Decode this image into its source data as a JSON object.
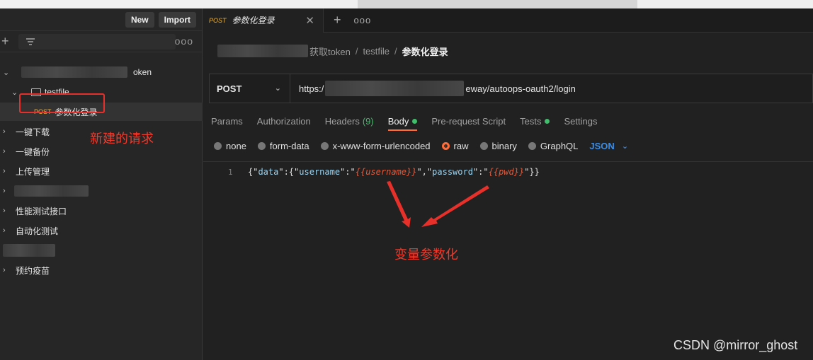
{
  "sidebar": {
    "new_label": "New",
    "import_label": "Import",
    "items": [
      {
        "label": "oken"
      },
      {
        "label": "testfile"
      },
      {
        "method": "POST",
        "label": "参数化登录"
      },
      {
        "label": "一键下载"
      },
      {
        "label": "一键备份"
      },
      {
        "label": "上传管理"
      },
      {
        "label": "性能测试接口"
      },
      {
        "label": "自动化测试"
      },
      {
        "label": "预约疫苗"
      }
    ]
  },
  "annotations": {
    "new_request": "新建的请求",
    "param_vars": "变量参数化"
  },
  "tab": {
    "method": "POST",
    "title": "参数化登录"
  },
  "breadcrumb": {
    "part1": "获取token",
    "part2": "testfile",
    "current": "参数化登录"
  },
  "request": {
    "method": "POST",
    "url_start": "https:/",
    "url_end": "eway/autoops-oauth2/login"
  },
  "req_tabs": {
    "params": "Params",
    "authorization": "Authorization",
    "headers": "Headers",
    "headers_count": "(9)",
    "body": "Body",
    "prerequest": "Pre-request Script",
    "tests": "Tests",
    "settings": "Settings"
  },
  "body_options": {
    "none": "none",
    "form_data": "form-data",
    "urlencoded": "x-www-form-urlencoded",
    "raw": "raw",
    "binary": "binary",
    "graphql": "GraphQL",
    "format": "JSON"
  },
  "editor": {
    "line_no": "1",
    "p1": "{\"",
    "k1": "data",
    "p2": "\":{\"",
    "k2": "username",
    "p3": "\":\"",
    "v1": "{{username}}",
    "p4": "\",\"",
    "k3": "password",
    "p5": "\":\"",
    "v2": "{{pwd}}",
    "p6": "\"}}"
  },
  "watermark": "CSDN @mirror_ghost",
  "colors": {
    "accent": "#ff6c37",
    "annotation": "#ef3b2c",
    "post": "#f2b233",
    "json": "#3a8de6"
  }
}
